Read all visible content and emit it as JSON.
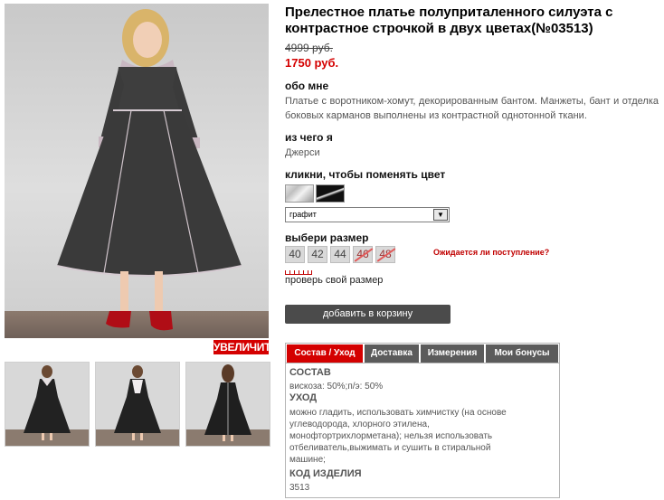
{
  "product": {
    "title": "Прелестное платье полуприталенного силуэта с контрастное строчкой в двух цветах(№03513)",
    "old_price": "4999 руб.",
    "new_price": "1750 руб."
  },
  "gallery": {
    "zoom_label": "УВЕЛИЧИТЬ"
  },
  "about": {
    "heading": "обо мне",
    "text": "Платье с воротником-хомут, декорированным бантом. Манжеты, бант и отделка боковых карманов выполнены из контрастной однотонной ткани."
  },
  "material": {
    "heading": "из чего я",
    "value": "Джерси"
  },
  "color": {
    "heading": "кликни, чтобы поменять цвет",
    "selected": "графит"
  },
  "size": {
    "heading": "выбери размер",
    "options": [
      {
        "label": "40",
        "available": true
      },
      {
        "label": "42",
        "available": true
      },
      {
        "label": "44",
        "available": true
      },
      {
        "label": "46",
        "available": false
      },
      {
        "label": "48",
        "available": false
      }
    ],
    "notify_link": "Ожидается ли поступление?",
    "check_link": "проверь свой размер"
  },
  "cart": {
    "button_label": "добавить в корзину"
  },
  "tabs": {
    "items": [
      "Состав / Уход",
      "Доставка",
      "Измерения",
      "Мои бонусы"
    ],
    "active": 0
  },
  "composition": {
    "heading": "СОСТАВ",
    "value": "вискоза: 50%;п/э: 50%",
    "care_heading": "УХОД",
    "care_text": "можно гладить, использовать химчистку (на основе углеводорода, хлорного этилена, монофтортрихлорметана); нельзя использовать отбеливатель,выжимать и сушить в стиральной машине;",
    "code_heading": "КОД ИЗДЕЛИЯ",
    "code_value": "3513"
  },
  "colors": {
    "accent_red": "#d40000",
    "button_dark": "#4b4b4b",
    "tab_gray": "#5b5b5b"
  }
}
